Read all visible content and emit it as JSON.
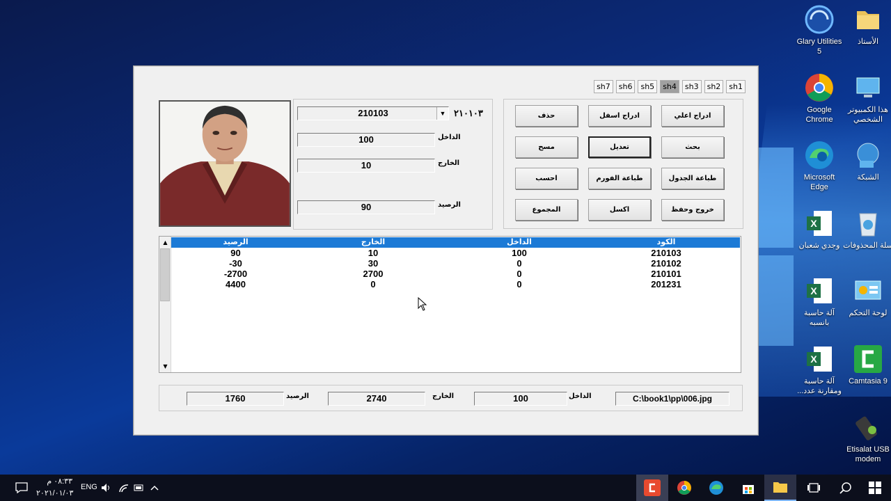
{
  "desktop": {
    "icons": [
      {
        "label": "Glary Utilities 5",
        "icon": "glary-utilities-icon"
      },
      {
        "label": "الأستاذ",
        "icon": "folder-icon"
      },
      {
        "label": "Google Chrome",
        "icon": "chrome-icon"
      },
      {
        "label": "هذا الكمبيوتر الشخصي",
        "icon": "this-pc-icon"
      },
      {
        "label": "Microsoft Edge",
        "icon": "edge-icon"
      },
      {
        "label": "الشبكة",
        "icon": "network-icon"
      },
      {
        "label": "وجدي شعبان",
        "icon": "excel-file-icon"
      },
      {
        "label": "سلة المحذوفات",
        "icon": "recycle-bin-icon"
      },
      {
        "label": "آلة حاسبة بانسبه",
        "icon": "excel-file-icon"
      },
      {
        "label": "لوحة التحكم",
        "icon": "control-panel-icon"
      },
      {
        "label": "آلة حاسبة ومقارنة عدد...",
        "icon": "excel-file-icon"
      },
      {
        "label": "Camtasia 9",
        "icon": "camtasia-icon"
      },
      {
        "label": "Etisalat USB modem",
        "icon": "usb-modem-icon"
      }
    ]
  },
  "app": {
    "sheet_tabs": [
      "sh7",
      "sh6",
      "sh5",
      "sh4",
      "sh3",
      "sh2",
      "sh1"
    ],
    "active_sheet": "sh4",
    "record": {
      "code_value": "210103",
      "code_label": "٢١٠١٠٣",
      "dakhel_label": "الداخل",
      "dakhel_value": "100",
      "kharej_label": "الخارج",
      "kharej_value": "10",
      "raseed_label": "الرصيد",
      "raseed_value": "90"
    },
    "buttons": {
      "insert_top": "ادراج اعلي",
      "insert_bottom": "ادراج اسفل",
      "delete": "حذف",
      "search": "بحث",
      "edit": "تعديل",
      "clear": "مسح",
      "print_table": "طباعة الجدول",
      "print_form": "طباعة الفورم",
      "calculate": "احسب",
      "exit_save": "خروج وحفظ",
      "excel": "اكسل",
      "total": "المجموع"
    },
    "table": {
      "headers": [
        "الرصيد",
        "الخارج",
        "الداخل",
        "الكود"
      ],
      "rows": [
        [
          "90",
          "10",
          "100",
          "210103"
        ],
        [
          "-30",
          "30",
          "0",
          "210102"
        ],
        [
          "-2700",
          "2700",
          "0",
          "210101"
        ],
        [
          "4400",
          "0",
          "0",
          "201231"
        ]
      ]
    },
    "totals": {
      "raseed_label": "الرصيد",
      "raseed_value": "1760",
      "kharej_label": "الخارج",
      "kharej_value": "2740",
      "dakhel_label": "الداخل",
      "dakhel_value": "100",
      "image_path": "C:\\book1\\pp\\006.jpg"
    }
  },
  "taskbar": {
    "time": "٠٨:٣٣ م",
    "date": "٢٠٢١/٠١/٠٣",
    "language": "ENG"
  },
  "colors": {
    "list_header": "#1c7ad6",
    "window_bg": "#f0f0f0",
    "active_tab": "#a0a0a0"
  }
}
